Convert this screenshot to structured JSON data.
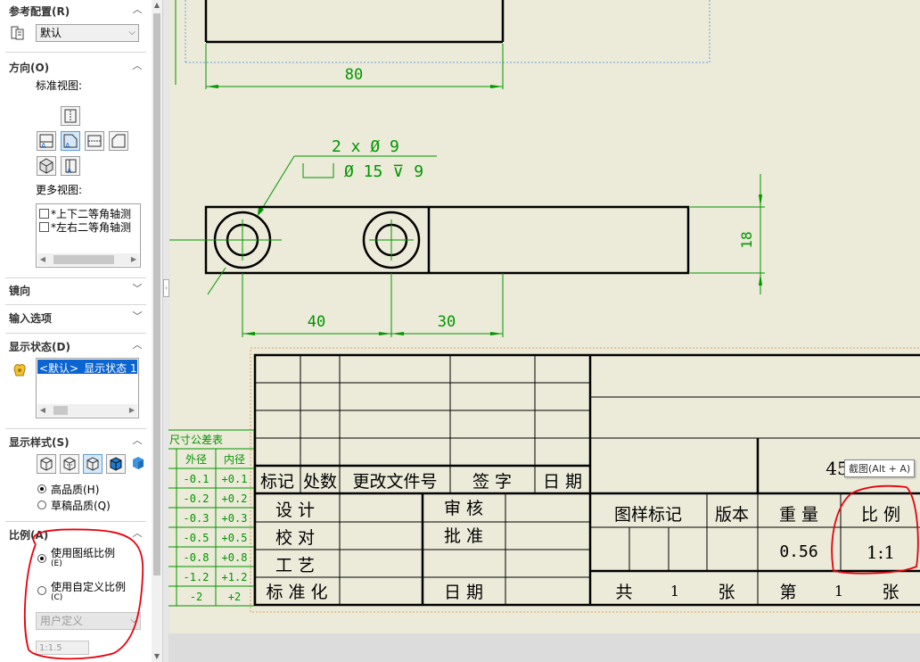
{
  "panel": {
    "ref_config": {
      "title": "参考配置(R)",
      "value": "默认"
    },
    "orientation": {
      "title": "方向(O)",
      "standard_views_label": "标准视图:",
      "more_views_label": "更多视图:",
      "more_views": [
        "*上下二等角轴测",
        "*左右二等角轴测"
      ]
    },
    "mirror": {
      "title": "镜向"
    },
    "import_options": {
      "title": "输入选项"
    },
    "display_state": {
      "title": "显示状态(D)",
      "item": "<默认>_显示状态 1"
    },
    "display_style": {
      "title": "显示样式(S)",
      "high_quality": "高品质(H)",
      "draft_quality": "草稿品质(Q)"
    },
    "scale": {
      "title": "比例(A)",
      "use_sheet_scale": "使用图纸比例",
      "use_sheet_scale_key": "(E)",
      "use_custom_scale": "使用自定义比例",
      "use_custom_scale_key": "(C)",
      "custom_combo": "用户定义",
      "custom_value": "1:1.5"
    }
  },
  "drawing": {
    "dims": {
      "d80": "80",
      "d40": "40",
      "d30": "30",
      "d18": "18"
    },
    "hole_callout": {
      "line1": "2 x  Ø  9",
      "line2": "Ø  15  ⊽  9"
    },
    "tolerance_table": {
      "title": "尺寸公差表",
      "headers": [
        "外径",
        "内径"
      ],
      "rows": [
        [
          "-0.1",
          "+0.1"
        ],
        [
          "-0.2",
          "+0.2"
        ],
        [
          "-0.3",
          "+0.3"
        ],
        [
          "-0.5",
          "+0.5"
        ],
        [
          "-0.8",
          "+0.8"
        ],
        [
          "-1.2",
          "+1.2"
        ],
        [
          "-2",
          "+2"
        ]
      ]
    },
    "title_block": {
      "rev_header": [
        "标记",
        "处数",
        "更改文件号",
        "签 字",
        "日 期"
      ],
      "left_labels": [
        "设 计",
        "校 对",
        "工 艺",
        "标 准 化"
      ],
      "mid_labels": [
        "审 核",
        "批 准",
        "日 期"
      ],
      "material": "45",
      "info_headers": [
        "图样标记",
        "版本",
        "重 量",
        "比 例"
      ],
      "weight": "0.56",
      "scale": "1:1",
      "sheet_total_prefix": "共",
      "sheet_total": "1",
      "sheet_unit": "张",
      "sheet_num_prefix": "第",
      "sheet_num": "1"
    },
    "tooltip": "截图(Alt + A)"
  },
  "colors": {
    "dimension": "#009600",
    "outline": "#000000",
    "annotation": "#e8000b",
    "selection": "#0a64d2"
  }
}
